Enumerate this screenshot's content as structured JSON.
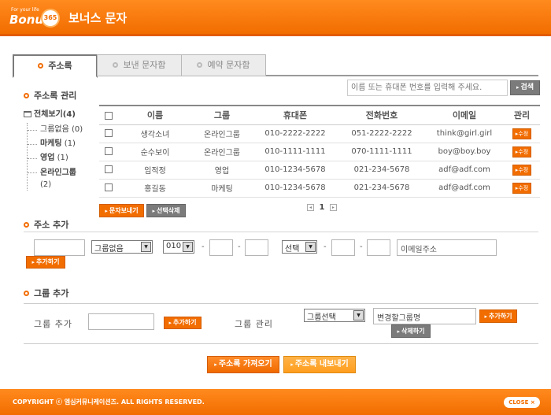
{
  "header": {
    "logo_small": "For your life",
    "logo_word": "Bonus",
    "logo_num": "365",
    "title": "보너스 문자"
  },
  "tabs": [
    {
      "label": "주소록"
    },
    {
      "label": "보낸 문자함"
    },
    {
      "label": "예약 문자함"
    }
  ],
  "address_book": {
    "section_title": "주소록 관리",
    "search_placeholder": "이름 또는 휴대폰 번호를 입력해 주세요.",
    "search_button": "검색",
    "tree": {
      "root": "전체보기(4)",
      "items": [
        {
          "label": "그룹없음",
          "count": "(0)"
        },
        {
          "label": "마케팅",
          "count": "(1)"
        },
        {
          "label": "영업",
          "count": "(1)"
        },
        {
          "label": "온라인그룹",
          "count": "(2)"
        }
      ]
    },
    "columns": [
      "이름",
      "그룹",
      "휴대폰",
      "전화번호",
      "이메일",
      "관리"
    ],
    "rows": [
      {
        "name": "생각소녀",
        "group": "온라인그룹",
        "mobile": "010-2222-2222",
        "phone": "051-2222-2222",
        "email": "think@girl.girl",
        "action": "수정"
      },
      {
        "name": "순수보이",
        "group": "온라인그룹",
        "mobile": "010-1111-1111",
        "phone": "070-1111-1111",
        "email": "boy@boy.boy",
        "action": "수정"
      },
      {
        "name": "임적정",
        "group": "영업",
        "mobile": "010-1234-5678",
        "phone": "021-234-5678",
        "email": "adf@adf.com",
        "action": "수정"
      },
      {
        "name": "홍길동",
        "group": "마케팅",
        "mobile": "010-1234-5678",
        "phone": "021-234-5678",
        "email": "adf@adf.com",
        "action": "수정"
      }
    ],
    "send_button": "문자보내기",
    "delete_button": "선택삭제",
    "page": "1"
  },
  "add_address": {
    "section_title": "주소 추가",
    "group_select": "그룹없음",
    "mobile_prefix": "010",
    "phone_prefix": "선택",
    "email_placeholder": "이메일주소",
    "add_button": "추가하기"
  },
  "add_group": {
    "section_title": "그룹 추가",
    "label_add": "그룹 추가",
    "add_button": "추가하기",
    "label_manage": "그룹 관리",
    "group_select": "그룹선택",
    "rename_placeholder": "변경할그룹명",
    "rename_add_button": "추가하기",
    "delete_button": "삭제하기"
  },
  "bottom": {
    "import_button": "주소록 가져오기",
    "export_button": "주소록 내보내기"
  },
  "footer": {
    "copyright": "COPYRIGHT ⓒ 엠심커뮤니케이션즈. ALL RIGHTS RESERVED.",
    "close_button": "CLOSE ×"
  }
}
